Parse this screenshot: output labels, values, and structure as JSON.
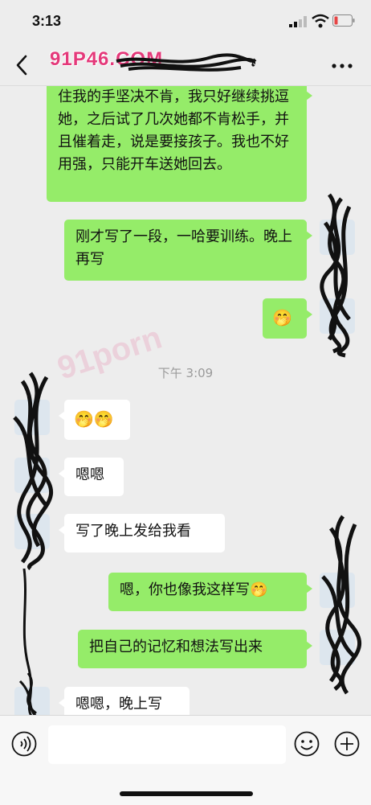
{
  "status_bar": {
    "time": "3:13"
  },
  "nav": {
    "watermark_title": "91P46.COM",
    "back_icon": "chevron-left-icon",
    "more_icon": "more-dots-icon"
  },
  "colors": {
    "mine_bubble": "#95ec69",
    "theirs_bubble": "#ffffff",
    "background": "#ededed",
    "watermark": "#e4397a"
  },
  "messages": [
    {
      "from": "me",
      "text": "住我的手坚决不肯，我只好继续挑逗她，之后试了几次她都不肯松手，并且催着走，说是要接孩子。我也不好用强，只能开车送她回去。"
    },
    {
      "from": "me",
      "text": "刚才写了一段，一哈要训练。晚上再写"
    },
    {
      "from": "me",
      "text": "🤭"
    },
    {
      "timestamp": "下午 3:09"
    },
    {
      "from": "them",
      "text": "🤭🤭"
    },
    {
      "from": "them",
      "text": "嗯嗯"
    },
    {
      "from": "them",
      "text": "写了晚上发给我看"
    },
    {
      "from": "me",
      "text": "嗯，你也像我这样写🤭"
    },
    {
      "from": "me",
      "text": "把自己的记忆和想法写出来"
    },
    {
      "from": "them",
      "text": "嗯嗯，晚上写"
    }
  ],
  "input": {
    "value": "",
    "voice_icon": "voice-icon",
    "emoji_icon": "emoji-icon",
    "plus_icon": "plus-icon"
  }
}
